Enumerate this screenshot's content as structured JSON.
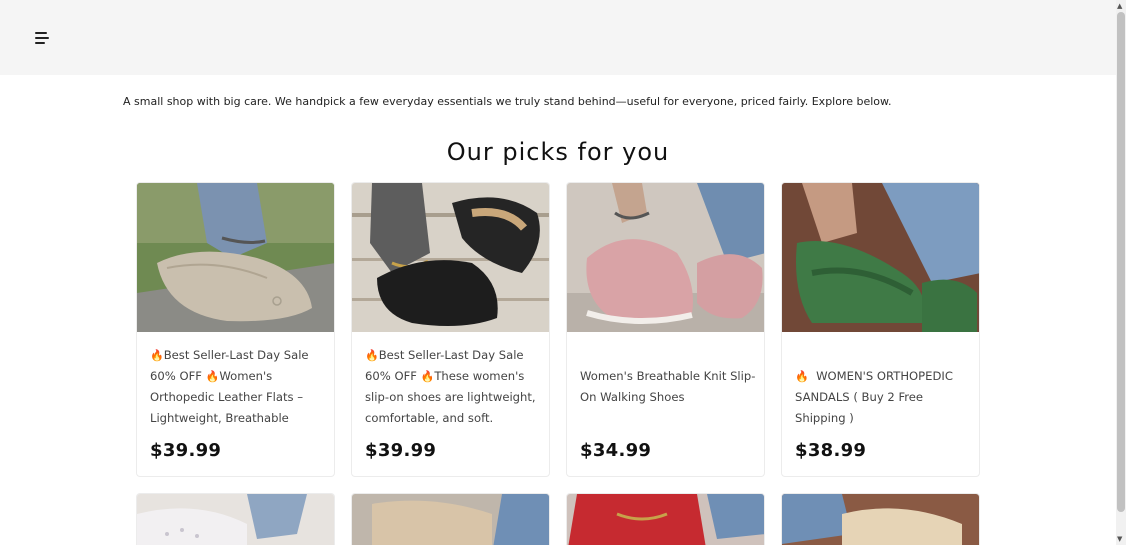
{
  "header": {
    "menu_icon": "hamburger-menu-icon"
  },
  "intro": "A small shop with big care. We handpick a few everyday essentials we truly stand behind—useful for everyone, priced fairly. Explore below.",
  "section_title": "Our picks for you",
  "products": [
    {
      "title_parts": [
        "Best Seller-Last Day Sale 60% OFF",
        "Women's Orthopedic Leather Flats – Lightweight, Breathable"
      ],
      "price": "$39.99",
      "image": "beige-loafer-photo"
    },
    {
      "title_parts": [
        "Best Seller-Last Day Sale 60% OFF",
        "These women's slip-on shoes are lightweight, comfortable, and soft."
      ],
      "price": "$39.99",
      "image": "black-slip-on-photo"
    },
    {
      "title": "Women's Breathable Knit Slip-On Walking Shoes",
      "price": "$34.99",
      "image": "pink-knit-shoe-photo"
    },
    {
      "title": "WOMEN'S ORTHOPEDIC SANDALS ( Buy 2 Free Shipping )",
      "price": "$38.99",
      "image": "green-sandal-photo"
    }
  ],
  "colors": {
    "flame": "#e85d1c",
    "header_bg": "#f5f5f5"
  }
}
